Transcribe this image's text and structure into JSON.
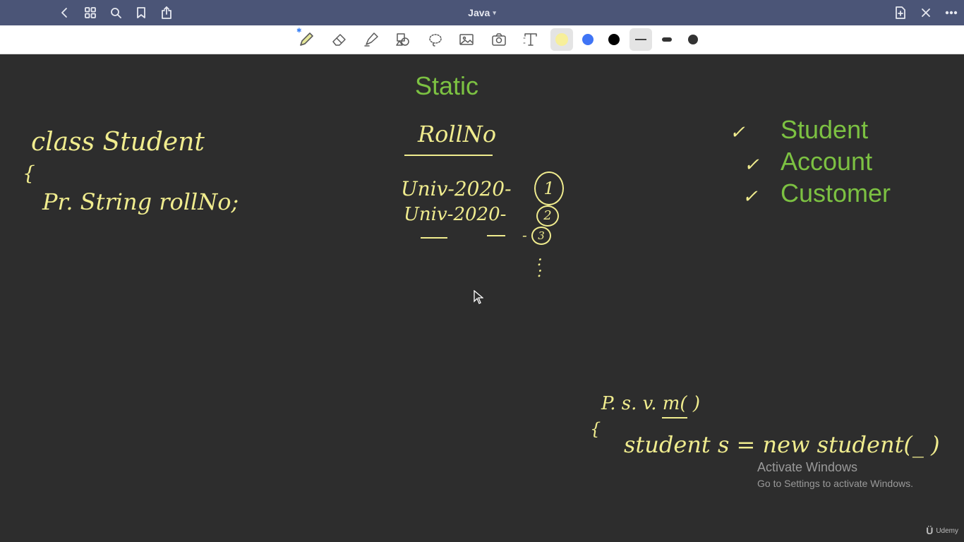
{
  "header": {
    "title": "Java",
    "icons": [
      "back-icon",
      "grid-icon",
      "search-icon",
      "bookmark-icon",
      "share-icon",
      "add-page-icon",
      "close-icon",
      "more-icon"
    ]
  },
  "toolbar": {
    "tools": [
      "pen-tool",
      "eraser-tool",
      "highlighter-tool",
      "shapes-tool",
      "lasso-tool",
      "image-tool",
      "camera-tool",
      "text-tool"
    ],
    "colors": [
      "#f7ef9a",
      "#3f74f5",
      "#000000"
    ],
    "stroke_sizes": [
      "thin",
      "medium",
      "thick"
    ]
  },
  "canvas": {
    "title": "Static",
    "list": [
      "Student",
      "Account",
      "Customer"
    ],
    "handwriting": {
      "class_line": "class Student",
      "brace_open": "{",
      "field_line": "Pr. String rollNo;",
      "rollno_header": "RollNo",
      "row1": "Univ-2020-",
      "row1_num": "1",
      "row2": "Univ-2020-",
      "row2_num": "2",
      "row3": "-",
      "row3_num": "3",
      "dots": ":",
      "main_line": "P. s. v. m( )",
      "brace_main": "{",
      "new_line": "student s = new student(_  )"
    },
    "ticks": [
      "✓",
      "✓",
      "✓"
    ]
  },
  "overlay": {
    "activate_title": "Activate Windows",
    "activate_sub": "Go to Settings to activate Windows.",
    "watermark": "Udemy"
  },
  "colors": {
    "titlebar": "#4b5577",
    "canvas_bg": "#2d2d2d",
    "green_text": "#7cc142",
    "handwriting": "#f0ec8e"
  }
}
